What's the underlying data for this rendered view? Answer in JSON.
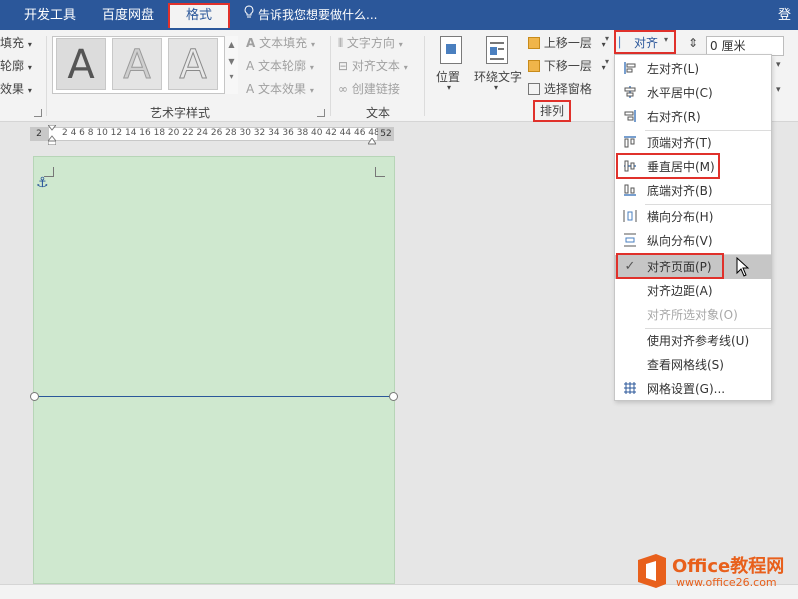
{
  "tabs": [
    {
      "label": "开发工具"
    },
    {
      "label": "百度网盘"
    },
    {
      "label": "格式"
    }
  ],
  "tellme": "告诉我您想要做什么...",
  "login": "登录",
  "left_cut": {
    "fill": "填充",
    "outline": "轮廓",
    "effect": "效果"
  },
  "wordart": {
    "letter": "A",
    "text_fill": "文本填充",
    "text_outline": "文本轮廓",
    "text_effect": "文本效果",
    "group_title": "艺术字样式"
  },
  "text_group": {
    "direction": "文字方向",
    "align_text": "对齐文本",
    "create_link": "创建链接",
    "group_title": "文本"
  },
  "arrange": {
    "position": "位置",
    "wrap_text": "环绕文字",
    "bring_forward": "上移一层",
    "send_backward": "下移一层",
    "selection_pane": "选择窗格",
    "group_title": "排列",
    "align": "对齐"
  },
  "size": {
    "height_value": "0 厘米"
  },
  "ruler": {
    "left_mark": "2",
    "numbers": "2  4  6  8 10 12 14 16 18 20 22 24 26 28 30 32 34 36 38 40 42 44 46 48",
    "right_mark": "52"
  },
  "menu": {
    "items": [
      {
        "icon": "align-left-icon",
        "label": "左对齐(L)"
      },
      {
        "icon": "align-center-icon",
        "label": "水平居中(C)"
      },
      {
        "icon": "align-right-icon",
        "label": "右对齐(R)"
      },
      {
        "icon": "align-top-icon",
        "label": "顶端对齐(T)"
      },
      {
        "icon": "align-middle-icon",
        "label": "垂直居中(M)"
      },
      {
        "icon": "align-bottom-icon",
        "label": "底端对齐(B)"
      },
      {
        "icon": "distribute-horizontal-icon",
        "label": "横向分布(H)"
      },
      {
        "icon": "distribute-vertical-icon",
        "label": "纵向分布(V)"
      },
      {
        "icon": "check-icon",
        "label": "对齐页面(P)"
      },
      {
        "icon": "",
        "label": "对齐边距(A)"
      },
      {
        "icon": "",
        "label": "对齐所选对象(O)"
      },
      {
        "icon": "",
        "label": "使用对齐参考线(U)"
      },
      {
        "icon": "",
        "label": "查看网格线(S)"
      },
      {
        "icon": "grid-icon",
        "label": "网格设置(G)..."
      }
    ]
  },
  "watermark": {
    "brand": "Office教程网",
    "url": "www.office26.com"
  },
  "colors": {
    "title_bar": "#2b579a",
    "highlight": "#e0312b",
    "page_fill": "#cfe8cf",
    "watermark_orange": "#e8601c"
  }
}
